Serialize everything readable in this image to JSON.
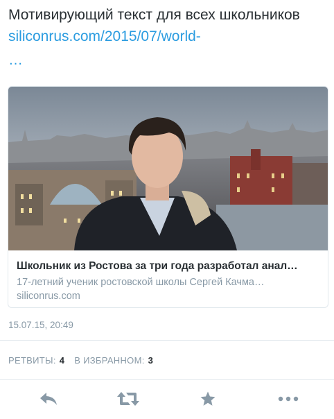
{
  "tweet": {
    "text": "Мотивирующий текст для всех школьников ",
    "link": "siliconrus.com/2015/07/world-",
    "link_ellipsis": "…"
  },
  "card": {
    "title": "Школьник из Ростова за три года разработал анал…",
    "description": "17-летний ученик ростовской школы Сергей Качма…",
    "domain": "siliconrus.com"
  },
  "timestamp": "15.07.15, 20:49",
  "stats": {
    "retweets_label": "РЕТВИТЫ:",
    "retweets_count": "4",
    "favorites_label": "В ИЗБРАННОМ:",
    "favorites_count": "3"
  },
  "actions": {
    "icons": [
      "reply-icon",
      "retweet-icon",
      "favorite-star-icon",
      "more-icon"
    ],
    "icon_color": "#8899a6"
  },
  "colors": {
    "link": "#2b9ce0",
    "text": "#292f33",
    "secondary": "#8899a6",
    "divider": "#e1e8ed"
  }
}
